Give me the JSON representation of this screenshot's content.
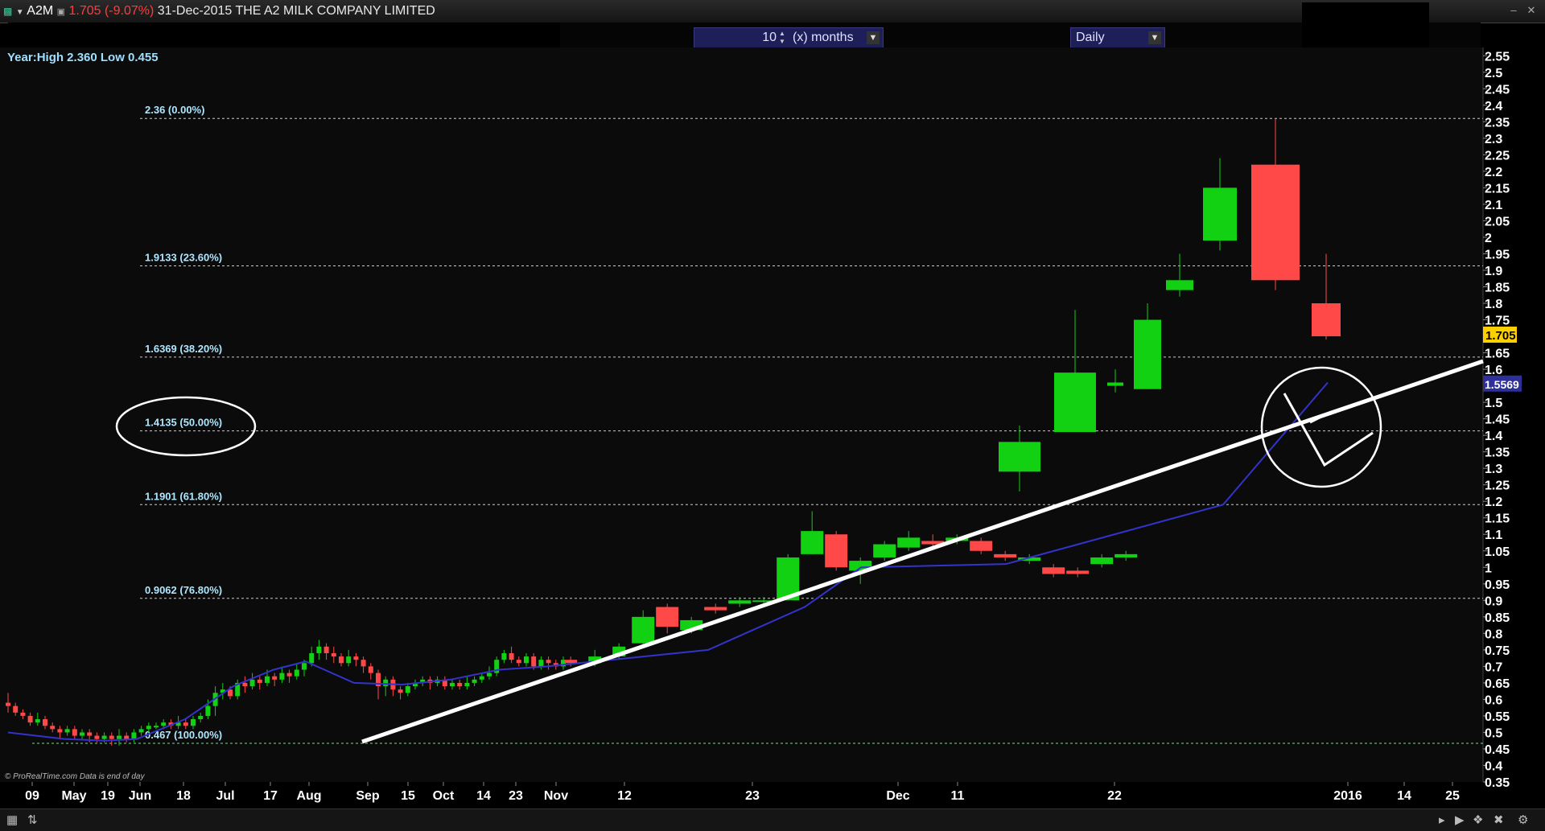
{
  "window": {
    "symbol": "A2M",
    "change": "1.705 (-9.07%)",
    "date": "31-Dec-2015",
    "company": "THE A2 MILK COMPANY LIMITED"
  },
  "toolbar": {
    "months_value": "10",
    "months_label": "(x) months",
    "period": "Daily"
  },
  "year_range": "Year:High 2.360 Low 0.455",
  "credit": {
    "source": "© ProRealTime.com",
    "note": "Data is end of day"
  },
  "colors": {
    "up": "#12d012",
    "down": "#ff4848",
    "ma": "#3333cc",
    "price_tag": "#ffd000",
    "ma_tag": "#2f2f9a"
  },
  "chart_data": {
    "type": "candlestick",
    "ylim": [
      0.35,
      2.575
    ],
    "yticks": [
      "2.55",
      "2.5",
      "2.45",
      "2.4",
      "2.35",
      "2.3",
      "2.25",
      "2.2",
      "2.15",
      "2.1",
      "2.05",
      "2",
      "1.95",
      "1.9",
      "1.85",
      "1.8",
      "1.75",
      "1.7",
      "1.65",
      "1.6",
      "1.55",
      "1.5",
      "1.45",
      "1.4",
      "1.35",
      "1.3",
      "1.25",
      "1.2",
      "1.15",
      "1.1",
      "1.05",
      "1",
      "0.95",
      "0.9",
      "0.85",
      "0.8",
      "0.75",
      "0.7",
      "0.65",
      "0.6",
      "0.55",
      "0.5",
      "0.45",
      "0.4",
      "0.35"
    ],
    "xticks": [
      "09",
      "May",
      "19",
      "Jun",
      "18",
      "Jul",
      "17",
      "Aug",
      "Sep",
      "15",
      "Oct",
      "14",
      "23",
      "Nov",
      "12",
      "23",
      "Dec",
      "11",
      "22",
      "2016",
      "14",
      "25"
    ],
    "last_price": "1.705",
    "ma_value": "1.5569",
    "fib_levels": [
      {
        "value": 2.36,
        "label": "2.36 (0.00%)"
      },
      {
        "value": 1.9133,
        "label": "1.9133 (23.60%)"
      },
      {
        "value": 1.6369,
        "label": "1.6369 (38.20%)"
      },
      {
        "value": 1.4135,
        "label": "1.4135 (50.00%)"
      },
      {
        "value": 1.1901,
        "label": "1.1901 (61.80%)"
      },
      {
        "value": 0.9062,
        "label": "0.9062 (76.80%)"
      },
      {
        "value": 0.467,
        "label": "0.467 (100.00%)"
      }
    ],
    "candles": [
      [
        0.59,
        0.58,
        0.62,
        0.56
      ],
      [
        0.58,
        0.56,
        0.59,
        0.55
      ],
      [
        0.56,
        0.55,
        0.57,
        0.54
      ],
      [
        0.55,
        0.53,
        0.56,
        0.52
      ],
      [
        0.53,
        0.54,
        0.56,
        0.52
      ],
      [
        0.54,
        0.52,
        0.55,
        0.51
      ],
      [
        0.52,
        0.51,
        0.53,
        0.5
      ],
      [
        0.51,
        0.5,
        0.52,
        0.48
      ],
      [
        0.5,
        0.51,
        0.52,
        0.49
      ],
      [
        0.51,
        0.49,
        0.52,
        0.48
      ],
      [
        0.49,
        0.5,
        0.51,
        0.48
      ],
      [
        0.5,
        0.49,
        0.51,
        0.47
      ],
      [
        0.49,
        0.48,
        0.5,
        0.47
      ],
      [
        0.48,
        0.49,
        0.5,
        0.47
      ],
      [
        0.49,
        0.48,
        0.5,
        0.46
      ],
      [
        0.48,
        0.49,
        0.51,
        0.46
      ],
      [
        0.49,
        0.48,
        0.5,
        0.47
      ],
      [
        0.48,
        0.5,
        0.51,
        0.47
      ],
      [
        0.5,
        0.51,
        0.52,
        0.49
      ],
      [
        0.51,
        0.52,
        0.53,
        0.5
      ],
      [
        0.52,
        0.52,
        0.53,
        0.51
      ],
      [
        0.52,
        0.53,
        0.54,
        0.51
      ],
      [
        0.53,
        0.52,
        0.54,
        0.51
      ],
      [
        0.52,
        0.53,
        0.55,
        0.51
      ],
      [
        0.53,
        0.52,
        0.54,
        0.51
      ],
      [
        0.52,
        0.54,
        0.55,
        0.51
      ],
      [
        0.54,
        0.55,
        0.56,
        0.53
      ],
      [
        0.55,
        0.58,
        0.6,
        0.54
      ],
      [
        0.58,
        0.62,
        0.64,
        0.55
      ],
      [
        0.62,
        0.63,
        0.65,
        0.6
      ],
      [
        0.63,
        0.61,
        0.64,
        0.6
      ],
      [
        0.61,
        0.65,
        0.66,
        0.6
      ],
      [
        0.65,
        0.64,
        0.67,
        0.62
      ],
      [
        0.64,
        0.66,
        0.68,
        0.63
      ],
      [
        0.66,
        0.65,
        0.67,
        0.63
      ],
      [
        0.65,
        0.67,
        0.69,
        0.64
      ],
      [
        0.67,
        0.66,
        0.68,
        0.64
      ],
      [
        0.66,
        0.68,
        0.7,
        0.65
      ],
      [
        0.68,
        0.67,
        0.69,
        0.65
      ],
      [
        0.67,
        0.69,
        0.71,
        0.66
      ],
      [
        0.69,
        0.71,
        0.72,
        0.67
      ],
      [
        0.71,
        0.74,
        0.76,
        0.7
      ],
      [
        0.74,
        0.76,
        0.78,
        0.72
      ],
      [
        0.76,
        0.74,
        0.77,
        0.72
      ],
      [
        0.74,
        0.73,
        0.76,
        0.71
      ],
      [
        0.73,
        0.71,
        0.74,
        0.7
      ],
      [
        0.71,
        0.73,
        0.75,
        0.7
      ],
      [
        0.73,
        0.72,
        0.74,
        0.7
      ],
      [
        0.72,
        0.7,
        0.73,
        0.68
      ],
      [
        0.7,
        0.68,
        0.71,
        0.66
      ],
      [
        0.68,
        0.64,
        0.69,
        0.6
      ],
      [
        0.64,
        0.66,
        0.67,
        0.61
      ],
      [
        0.66,
        0.63,
        0.67,
        0.61
      ],
      [
        0.63,
        0.62,
        0.64,
        0.6
      ],
      [
        0.62,
        0.64,
        0.65,
        0.61
      ],
      [
        0.64,
        0.65,
        0.66,
        0.63
      ],
      [
        0.65,
        0.66,
        0.67,
        0.64
      ],
      [
        0.66,
        0.65,
        0.67,
        0.63
      ],
      [
        0.65,
        0.66,
        0.67,
        0.64
      ],
      [
        0.66,
        0.64,
        0.67,
        0.63
      ],
      [
        0.64,
        0.65,
        0.66,
        0.63
      ],
      [
        0.65,
        0.64,
        0.66,
        0.63
      ],
      [
        0.64,
        0.65,
        0.67,
        0.63
      ],
      [
        0.65,
        0.66,
        0.67,
        0.64
      ],
      [
        0.66,
        0.67,
        0.68,
        0.65
      ],
      [
        0.67,
        0.68,
        0.7,
        0.66
      ],
      [
        0.68,
        0.72,
        0.73,
        0.67
      ],
      [
        0.72,
        0.74,
        0.75,
        0.71
      ],
      [
        0.74,
        0.72,
        0.76,
        0.71
      ],
      [
        0.72,
        0.71,
        0.73,
        0.7
      ],
      [
        0.71,
        0.73,
        0.74,
        0.7
      ],
      [
        0.73,
        0.7,
        0.74,
        0.69
      ],
      [
        0.7,
        0.72,
        0.73,
        0.69
      ],
      [
        0.72,
        0.71,
        0.73,
        0.69
      ],
      [
        0.71,
        0.7,
        0.72,
        0.69
      ],
      [
        0.7,
        0.72,
        0.73,
        0.69
      ],
      [
        0.72,
        0.71,
        0.73,
        0.7
      ],
      [
        0.71,
        0.73,
        0.75,
        0.7
      ],
      [
        0.73,
        0.76,
        0.77,
        0.72
      ],
      [
        0.77,
        0.85,
        0.87,
        0.76
      ],
      [
        0.88,
        0.82,
        0.89,
        0.8
      ],
      [
        0.81,
        0.84,
        0.85,
        0.8
      ],
      [
        0.88,
        0.87,
        0.89,
        0.86
      ],
      [
        0.89,
        0.9,
        0.91,
        0.88
      ],
      [
        0.9,
        0.9,
        0.91,
        0.89
      ],
      [
        0.9,
        1.03,
        1.04,
        0.9
      ],
      [
        1.04,
        1.11,
        1.17,
        1.04
      ],
      [
        1.1,
        1.0,
        1.11,
        0.99
      ],
      [
        0.99,
        1.02,
        1.03,
        0.95
      ],
      [
        1.03,
        1.07,
        1.08,
        1.02
      ],
      [
        1.06,
        1.09,
        1.11,
        1.05
      ],
      [
        1.08,
        1.07,
        1.1,
        1.06
      ],
      [
        1.08,
        1.09,
        1.1,
        1.07
      ],
      [
        1.08,
        1.05,
        1.09,
        1.04
      ],
      [
        1.04,
        1.03,
        1.05,
        1.02
      ],
      [
        1.02,
        1.03,
        1.04,
        1.01
      ],
      [
        1.0,
        0.98,
        1.01,
        0.97
      ],
      [
        0.99,
        0.98,
        1.0,
        0.97
      ],
      [
        1.01,
        1.03,
        1.04,
        1.0
      ],
      [
        1.03,
        1.04,
        1.05,
        1.02
      ],
      [
        1.29,
        1.38,
        1.43,
        1.23
      ],
      [
        1.41,
        1.59,
        1.78,
        1.41
      ],
      [
        1.55,
        1.56,
        1.6,
        1.53
      ],
      [
        1.54,
        1.75,
        1.8,
        1.54
      ],
      [
        1.84,
        1.87,
        1.95,
        1.82
      ],
      [
        1.99,
        2.15,
        2.24,
        1.96
      ],
      [
        2.22,
        1.87,
        2.36,
        1.84
      ],
      [
        1.8,
        1.7,
        1.95,
        1.69
      ]
    ],
    "ma_line": [
      [
        "09",
        0.5
      ],
      [
        "May",
        0.48
      ],
      [
        "19",
        0.475
      ],
      [
        "Jun",
        0.48
      ],
      [
        "18",
        0.54
      ],
      [
        "Jul",
        0.64
      ],
      [
        "17",
        0.69
      ],
      [
        "Aug",
        0.715
      ],
      [
        "Sep",
        0.65
      ],
      [
        "15",
        0.645
      ],
      [
        "Oct",
        0.66
      ],
      [
        "14",
        0.69
      ],
      [
        "23",
        0.7
      ],
      [
        "Nov",
        0.72
      ],
      [
        "12",
        0.75
      ],
      [
        "23",
        0.88
      ],
      [
        "Dec",
        1.0
      ],
      [
        "11",
        1.01
      ],
      [
        "22",
        1.19
      ],
      [
        "2016",
        1.56
      ]
    ]
  }
}
